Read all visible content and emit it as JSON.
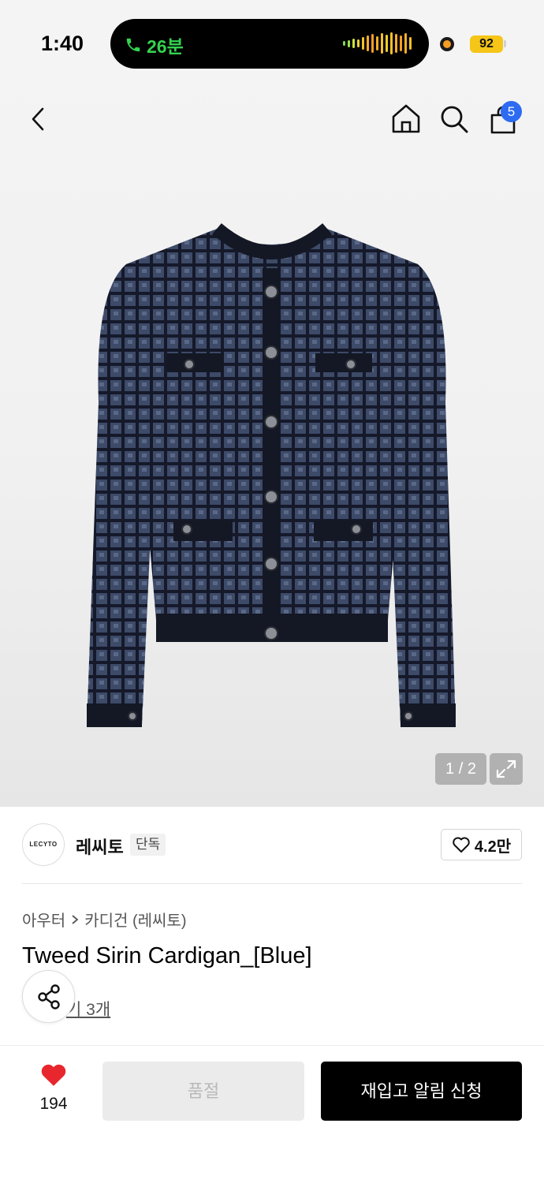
{
  "status_bar": {
    "time": "1:40",
    "call_duration": "26분",
    "battery": "92"
  },
  "header": {
    "cart_count": "5"
  },
  "gallery": {
    "counter": "1 / 2"
  },
  "brand": {
    "logo_text": "LECYTO",
    "name": "레씨토",
    "badge": "단독",
    "like_count": "4.2만"
  },
  "product": {
    "breadcrumb": [
      "아우터",
      "카디건 (레씨토)"
    ],
    "title": "Tweed Sirin Cardigan_[Blue]",
    "review_text": "기 3개"
  },
  "bottom_bar": {
    "wish_count": "194",
    "soldout_label": "품절",
    "restock_label": "재입고 알림 신청"
  },
  "colors": {
    "badge_blue": "#2c6bf2",
    "wish_red": "#e8262d",
    "call_green": "#34d24f",
    "battery_yellow": "#f5c518"
  }
}
